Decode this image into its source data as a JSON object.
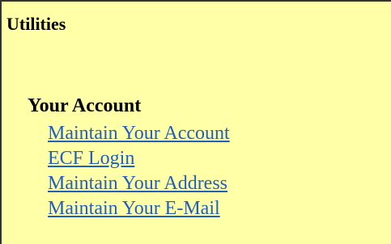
{
  "section": {
    "title": "Utilities"
  },
  "account": {
    "heading": "Your Account",
    "links": [
      "Maintain Your Account",
      "ECF Login",
      "Maintain Your Address",
      "Maintain Your E-Mail"
    ]
  },
  "colors": {
    "background": "#ffffa8",
    "link": "#1f5fbf",
    "text": "#000000",
    "border": "#333333"
  }
}
